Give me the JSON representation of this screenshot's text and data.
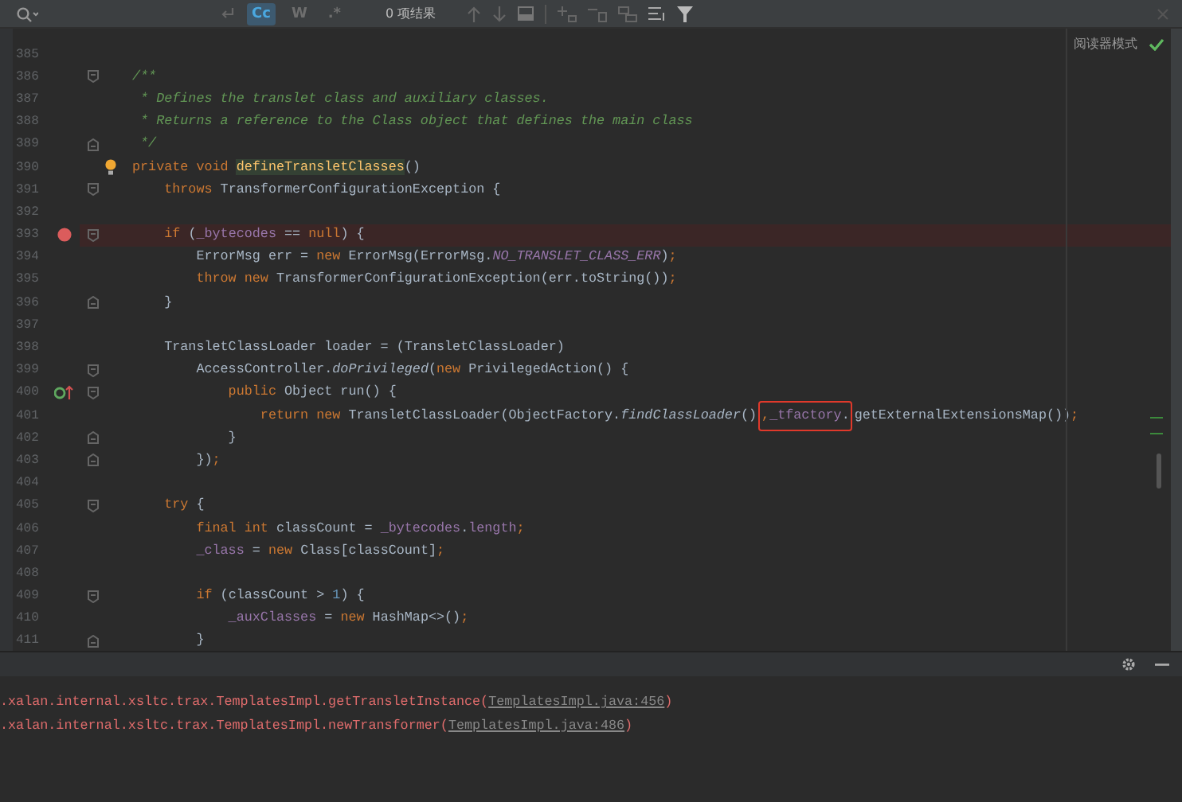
{
  "search_bar": {
    "toggles": [
      {
        "label": "Cc",
        "selected": true
      },
      {
        "label": "W",
        "selected": false
      },
      {
        "label": ".*",
        "selected": false
      }
    ],
    "result_count": "0 项结果"
  },
  "editor": {
    "reader_mode": "阅读器模式",
    "lines": [
      {
        "number": "385"
      },
      {
        "number": "386",
        "fold_icon": {
          "kind": "start"
        },
        "tokens": [
          {
            "kind": "comment",
            "text": "/**"
          }
        ]
      },
      {
        "number": "387",
        "tokens": [
          {
            "kind": "comment",
            "text": " * Defines the translet class and auxiliary classes."
          }
        ]
      },
      {
        "number": "388",
        "tokens": [
          {
            "kind": "comment",
            "text": " * Returns a reference to the Class object that defines the main class"
          }
        ]
      },
      {
        "number": "389",
        "fold_icon": {
          "kind": "end"
        },
        "tokens": [
          {
            "kind": "comment",
            "text": " */"
          }
        ]
      },
      {
        "number": "390",
        "gutter_icon": {
          "kind": "bulb"
        },
        "tokens": [
          {
            "kind": "kw",
            "text": "private void "
          },
          {
            "kind": "decl",
            "text": "defineTransletClasses"
          },
          {
            "kind": "plain",
            "text": "()"
          }
        ]
      },
      {
        "number": "391",
        "fold_icon": {
          "kind": "start"
        },
        "tokens": [
          {
            "kind": "kw",
            "text": "    throws "
          },
          {
            "kind": "plain",
            "text": "TransformerConfigurationException {"
          }
        ]
      },
      {
        "number": "392"
      },
      {
        "number": "393",
        "gutter_icon": {
          "kind": "breakpoint"
        },
        "fold_icon": {
          "kind": "start"
        },
        "tokens": [
          {
            "kind": "kw",
            "text": "    if "
          },
          {
            "kind": "plain",
            "text": "("
          },
          {
            "kind": "field",
            "text": "_bytecodes"
          },
          {
            "kind": "plain",
            "text": " == "
          },
          {
            "kind": "kw",
            "text": "null"
          },
          {
            "kind": "plain",
            "text": ") {"
          }
        ]
      },
      {
        "number": "394",
        "tokens": [
          {
            "kind": "plain",
            "text": "        ErrorMsg err = "
          },
          {
            "kind": "kw",
            "text": "new "
          },
          {
            "kind": "plain",
            "text": "ErrorMsg(ErrorMsg."
          },
          {
            "kind": "static",
            "text": "NO_TRANSLET_CLASS_ERR"
          },
          {
            "kind": "plain",
            "text": ")"
          },
          {
            "kind": "kw",
            "text": ";"
          }
        ]
      },
      {
        "number": "395",
        "tokens": [
          {
            "kind": "kw",
            "text": "        throw new "
          },
          {
            "kind": "plain",
            "text": "TransformerConfigurationException(err.toString())"
          },
          {
            "kind": "kw",
            "text": ";"
          }
        ]
      },
      {
        "number": "396",
        "fold_icon": {
          "kind": "end"
        },
        "tokens": [
          {
            "kind": "plain",
            "text": "    }"
          }
        ]
      },
      {
        "number": "397"
      },
      {
        "number": "398",
        "tokens": [
          {
            "kind": "plain",
            "text": "    TransletClassLoader loader = (TransletClassLoader)"
          }
        ]
      },
      {
        "number": "399",
        "fold_icon": {
          "kind": "start"
        },
        "tokens": [
          {
            "kind": "plain",
            "text": "        AccessController."
          },
          {
            "kind": "call",
            "text": "doPrivileged"
          },
          {
            "kind": "plain",
            "text": "("
          },
          {
            "kind": "kw",
            "text": "new "
          },
          {
            "kind": "plain",
            "text": "PrivilegedAction() {"
          }
        ]
      },
      {
        "number": "400",
        "gutter_icon": {
          "kind": "override"
        },
        "fold_icon": {
          "kind": "start"
        },
        "tokens": [
          {
            "kind": "kw",
            "text": "            public "
          },
          {
            "kind": "plain",
            "text": "Object run() {"
          }
        ]
      },
      {
        "number": "401",
        "tokens": [
          {
            "kind": "kw",
            "text": "                return new "
          },
          {
            "kind": "plain",
            "text": "TransletClassLoader(ObjectFactory."
          },
          {
            "kind": "call",
            "text": "findClassLoader"
          },
          {
            "kind": "plain",
            "text": "()"
          },
          {
            "kind": "kw",
            "text": ",",
            "boxed": true
          },
          {
            "kind": "field",
            "text": "_tfactory",
            "boxed": true
          },
          {
            "kind": "plain",
            "text": ".",
            "boxed": true
          },
          {
            "kind": "plain",
            "text": "getExternalExtensionsMap())"
          },
          {
            "kind": "kw",
            "text": ";"
          }
        ]
      },
      {
        "number": "402",
        "fold_icon": {
          "kind": "end"
        },
        "tokens": [
          {
            "kind": "plain",
            "text": "            }"
          }
        ]
      },
      {
        "number": "403",
        "fold_icon": {
          "kind": "end"
        },
        "tokens": [
          {
            "kind": "plain",
            "text": "        })"
          },
          {
            "kind": "kw",
            "text": ";"
          }
        ]
      },
      {
        "number": "404"
      },
      {
        "number": "405",
        "fold_icon": {
          "kind": "start"
        },
        "tokens": [
          {
            "kind": "kw",
            "text": "    try "
          },
          {
            "kind": "plain",
            "text": "{"
          }
        ]
      },
      {
        "number": "406",
        "tokens": [
          {
            "kind": "kw",
            "text": "        final int "
          },
          {
            "kind": "plain",
            "text": "classCount = "
          },
          {
            "kind": "field",
            "text": "_bytecodes"
          },
          {
            "kind": "plain",
            "text": "."
          },
          {
            "kind": "field",
            "text": "length"
          },
          {
            "kind": "kw",
            "text": ";"
          }
        ]
      },
      {
        "number": "407",
        "tokens": [
          {
            "kind": "field",
            "text": "        _class"
          },
          {
            "kind": "plain",
            "text": " = "
          },
          {
            "kind": "kw",
            "text": "new "
          },
          {
            "kind": "plain",
            "text": "Class[classCount]"
          },
          {
            "kind": "kw",
            "text": ";"
          }
        ]
      },
      {
        "number": "408"
      },
      {
        "number": "409",
        "fold_icon": {
          "kind": "start"
        },
        "tokens": [
          {
            "kind": "kw",
            "text": "        if "
          },
          {
            "kind": "plain",
            "text": "(classCount > "
          },
          {
            "kind": "num",
            "text": "1"
          },
          {
            "kind": "plain",
            "text": ") {"
          }
        ]
      },
      {
        "number": "410",
        "tokens": [
          {
            "kind": "field",
            "text": "            _auxClasses"
          },
          {
            "kind": "plain",
            "text": " = "
          },
          {
            "kind": "kw",
            "text": "new "
          },
          {
            "kind": "plain",
            "text": "HashMap<>()"
          },
          {
            "kind": "kw",
            "text": ";"
          }
        ]
      },
      {
        "number": "411",
        "fold_icon": {
          "kind": "end"
        },
        "tokens": [
          {
            "kind": "plain",
            "text": "        }"
          }
        ]
      }
    ]
  },
  "console": {
    "lines": [
      {
        "text": ".xalan.internal.xsltc.trax.TemplatesImpl.getTransletInstance(",
        "link": "TemplatesImpl.java:456",
        "end": ")"
      },
      {
        "text": ".xalan.internal.xsltc.trax.TemplatesImpl.newTransformer(",
        "link": "TemplatesImpl.java:486",
        "end": ")"
      }
    ]
  }
}
